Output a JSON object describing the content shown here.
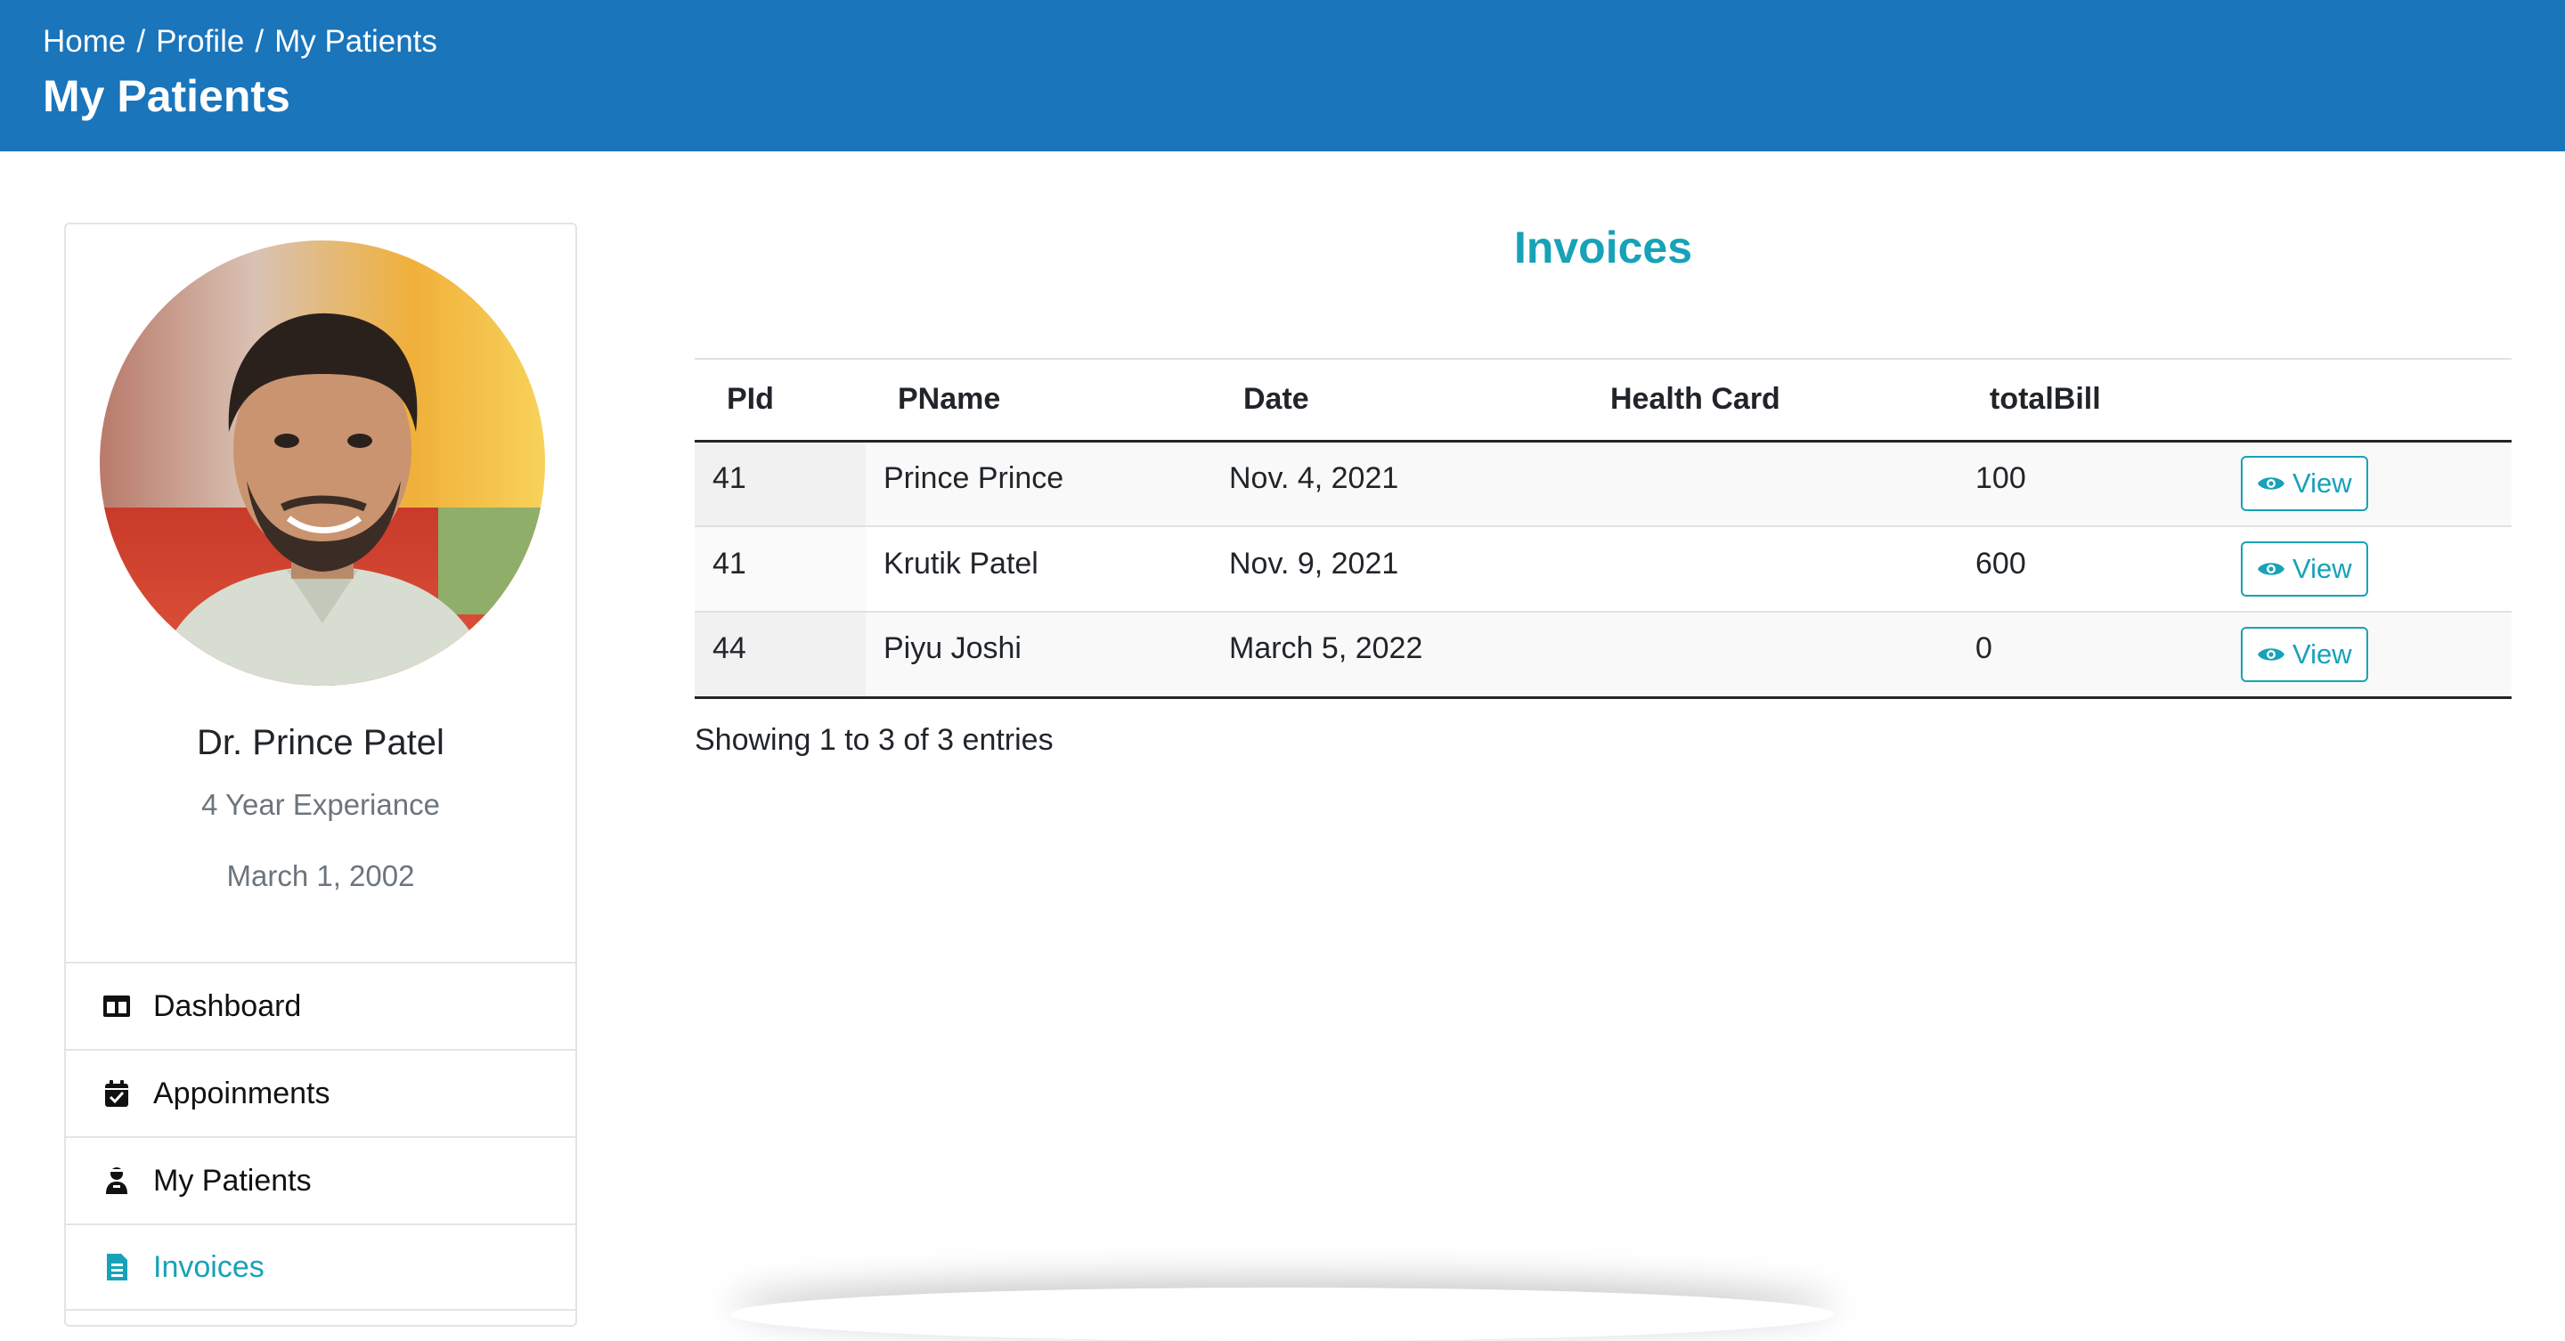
{
  "header": {
    "breadcrumb": [
      "Home",
      "Profile",
      "My Patients"
    ],
    "title": "My Patients",
    "color": "#1a75bb"
  },
  "profile": {
    "name": "Dr. Prince Patel",
    "experience": "4 Year Experiance",
    "date": "March 1, 2002"
  },
  "menu": {
    "items": [
      {
        "label": "Dashboard",
        "icon": "dashboard-icon",
        "active": false
      },
      {
        "label": "Appoinments",
        "icon": "calendar-check-icon",
        "active": false
      },
      {
        "label": "My Patients",
        "icon": "user-injured-icon",
        "active": false
      },
      {
        "label": "Invoices",
        "icon": "invoice-icon",
        "active": true
      }
    ]
  },
  "main": {
    "title": "Invoices",
    "accent_color": "#17a2b8",
    "columns": [
      "PId",
      "PName",
      "Date",
      "Health Card",
      "totalBill",
      ""
    ],
    "rows": [
      {
        "pid": "41",
        "pname": "Prince Prince",
        "date": "Nov. 4, 2021",
        "health_card": "",
        "total": "100",
        "action": "View"
      },
      {
        "pid": "41",
        "pname": "Krutik Patel",
        "date": "Nov. 9, 2021",
        "health_card": "",
        "total": "600",
        "action": "View"
      },
      {
        "pid": "44",
        "pname": "Piyu Joshi",
        "date": "March 5, 2022",
        "health_card": "",
        "total": "0",
        "action": "View"
      }
    ],
    "entries_info": "Showing 1 to 3 of 3 entries"
  }
}
